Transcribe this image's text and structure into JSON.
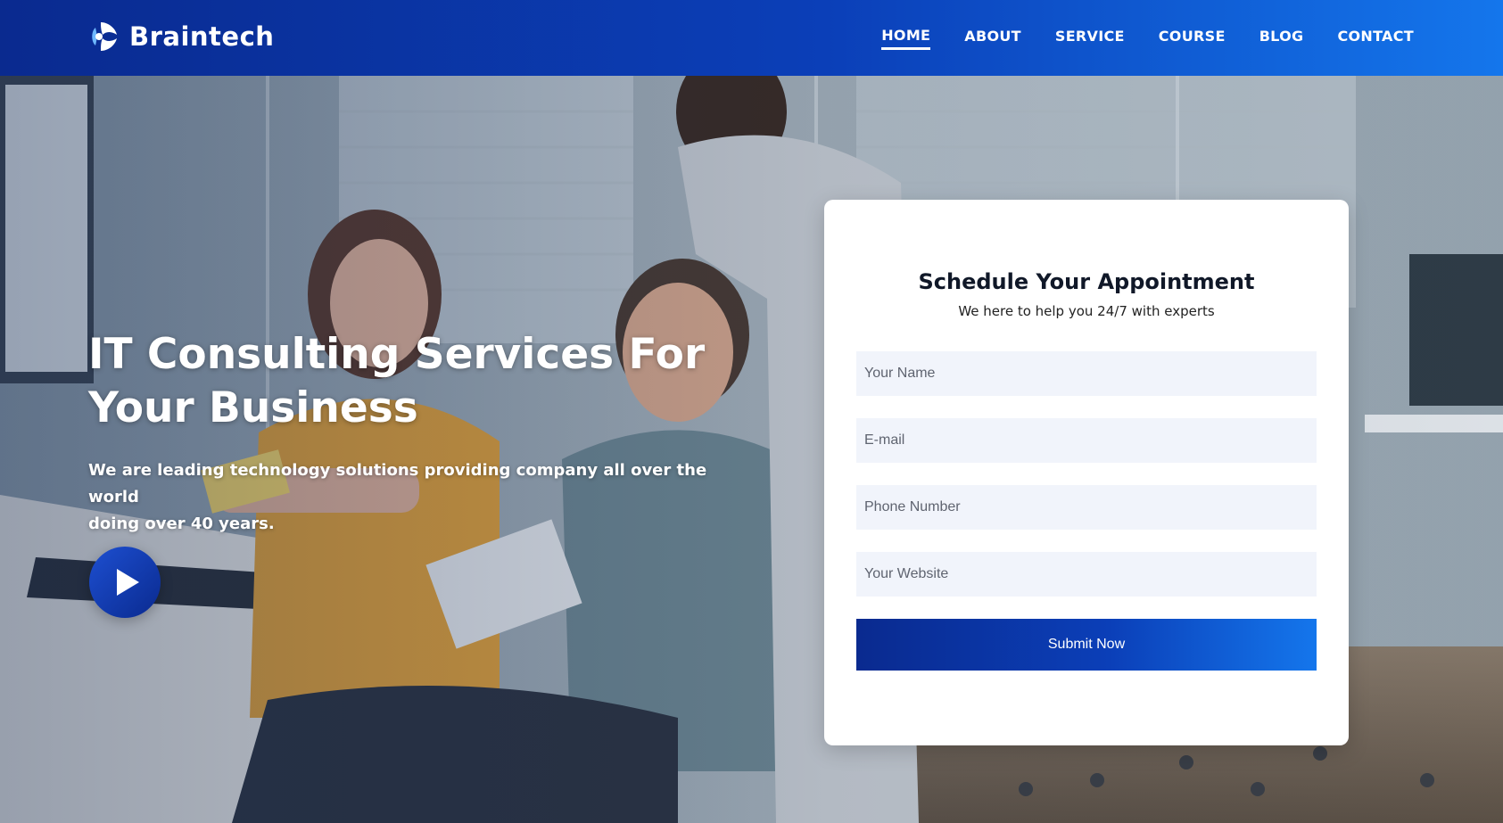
{
  "brand": {
    "name": "Braintech"
  },
  "nav": {
    "items": [
      {
        "label": "HOME",
        "active": true
      },
      {
        "label": "ABOUT"
      },
      {
        "label": "SERVICE"
      },
      {
        "label": "COURSE"
      },
      {
        "label": "BLOG"
      },
      {
        "label": "CONTACT"
      }
    ]
  },
  "hero": {
    "title_line1": "IT Consulting Services For",
    "title_line2": "Your Business",
    "subtitle_line1": "We are leading technology solutions providing company all over the world",
    "subtitle_line2": "doing over 40 years.",
    "play_icon": "play-icon"
  },
  "form": {
    "title": "Schedule Your Appointment",
    "subtitle": "We here to help you 24/7 with experts",
    "name_placeholder": "Your Name",
    "email_placeholder": "E-mail",
    "phone_placeholder": "Phone Number",
    "website_placeholder": "Your Website",
    "submit_label": "Submit Now"
  },
  "colors": {
    "header_start": "#0a2a8f",
    "header_end": "#1476ec",
    "field_bg": "#f1f4fb"
  }
}
